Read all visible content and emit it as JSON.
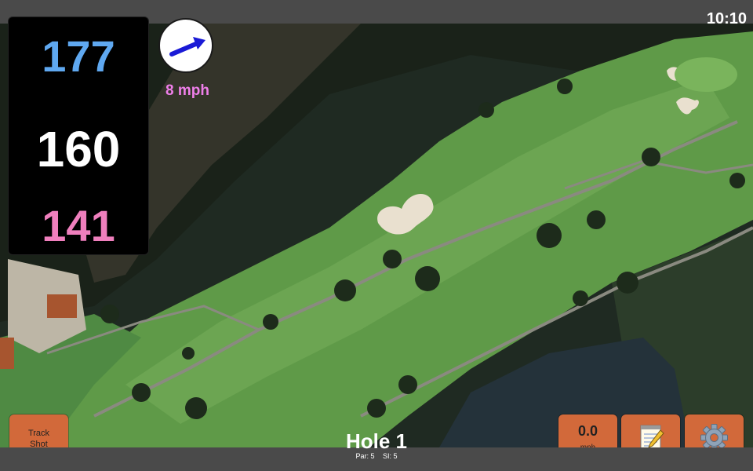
{
  "status_bar": {
    "time": "10:10"
  },
  "distances": {
    "back": "177",
    "center": "160",
    "front": "141"
  },
  "wind": {
    "speed": "8 mph",
    "direction": "east-northeast",
    "icon": "wind-arrow-icon"
  },
  "buttons": {
    "track_shot": [
      "Track",
      "Shot"
    ],
    "swing_speed": {
      "value": "0.0",
      "unit": "mph"
    },
    "scorecard_icon": "notepad-icon",
    "settings_icon": "gear-icon"
  },
  "hole": {
    "title": "Hole 1",
    "par": "Par: 5",
    "stroke_index": "SI: 5"
  },
  "colors": {
    "back_distance": "#5fa8f0",
    "center_distance": "#ffffff",
    "front_distance": "#ef7fbd",
    "wind_text": "#ef7fea",
    "button": "#d2693a",
    "fairway": "#5f9a48",
    "rough": "#3e6a35",
    "water": "#24323a"
  }
}
